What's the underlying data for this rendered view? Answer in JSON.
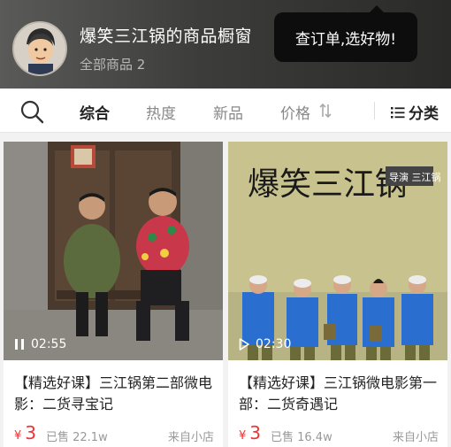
{
  "header": {
    "shop_name": "爆笑三江锅的商品橱窗",
    "all_goods": "全部商品 2",
    "order_prompt": "查订单,选好物!"
  },
  "tabs": [
    {
      "label": "综合",
      "active": true
    },
    {
      "label": "热度",
      "active": false
    },
    {
      "label": "新品",
      "active": false
    },
    {
      "label": "价格",
      "active": false
    }
  ],
  "category_label": "分类",
  "icons": {
    "search": "search-icon",
    "sort": "sort-arrows-icon",
    "category": "list-icon",
    "pause": "pause-icon",
    "play": "play-icon"
  },
  "products": [
    {
      "duration": "02:55",
      "title": "【精选好课】三江锅第二部微电影：二货寻宝记",
      "currency": "¥",
      "price": "3",
      "sold": "已售 22.1w",
      "from": "来自小店"
    },
    {
      "duration": "02:30",
      "title": "【精选好课】三江锅微电影第一部：二货奇遇记",
      "currency": "¥",
      "price": "3",
      "sold": "已售 16.4w",
      "from": "来自小店"
    }
  ],
  "poster": {
    "title": "爆笑三江锅",
    "badge": "导演 三江锅"
  },
  "colors": {
    "price": "#ee3333",
    "active_tab": "#222222",
    "bubble": "#0d0d0d"
  }
}
